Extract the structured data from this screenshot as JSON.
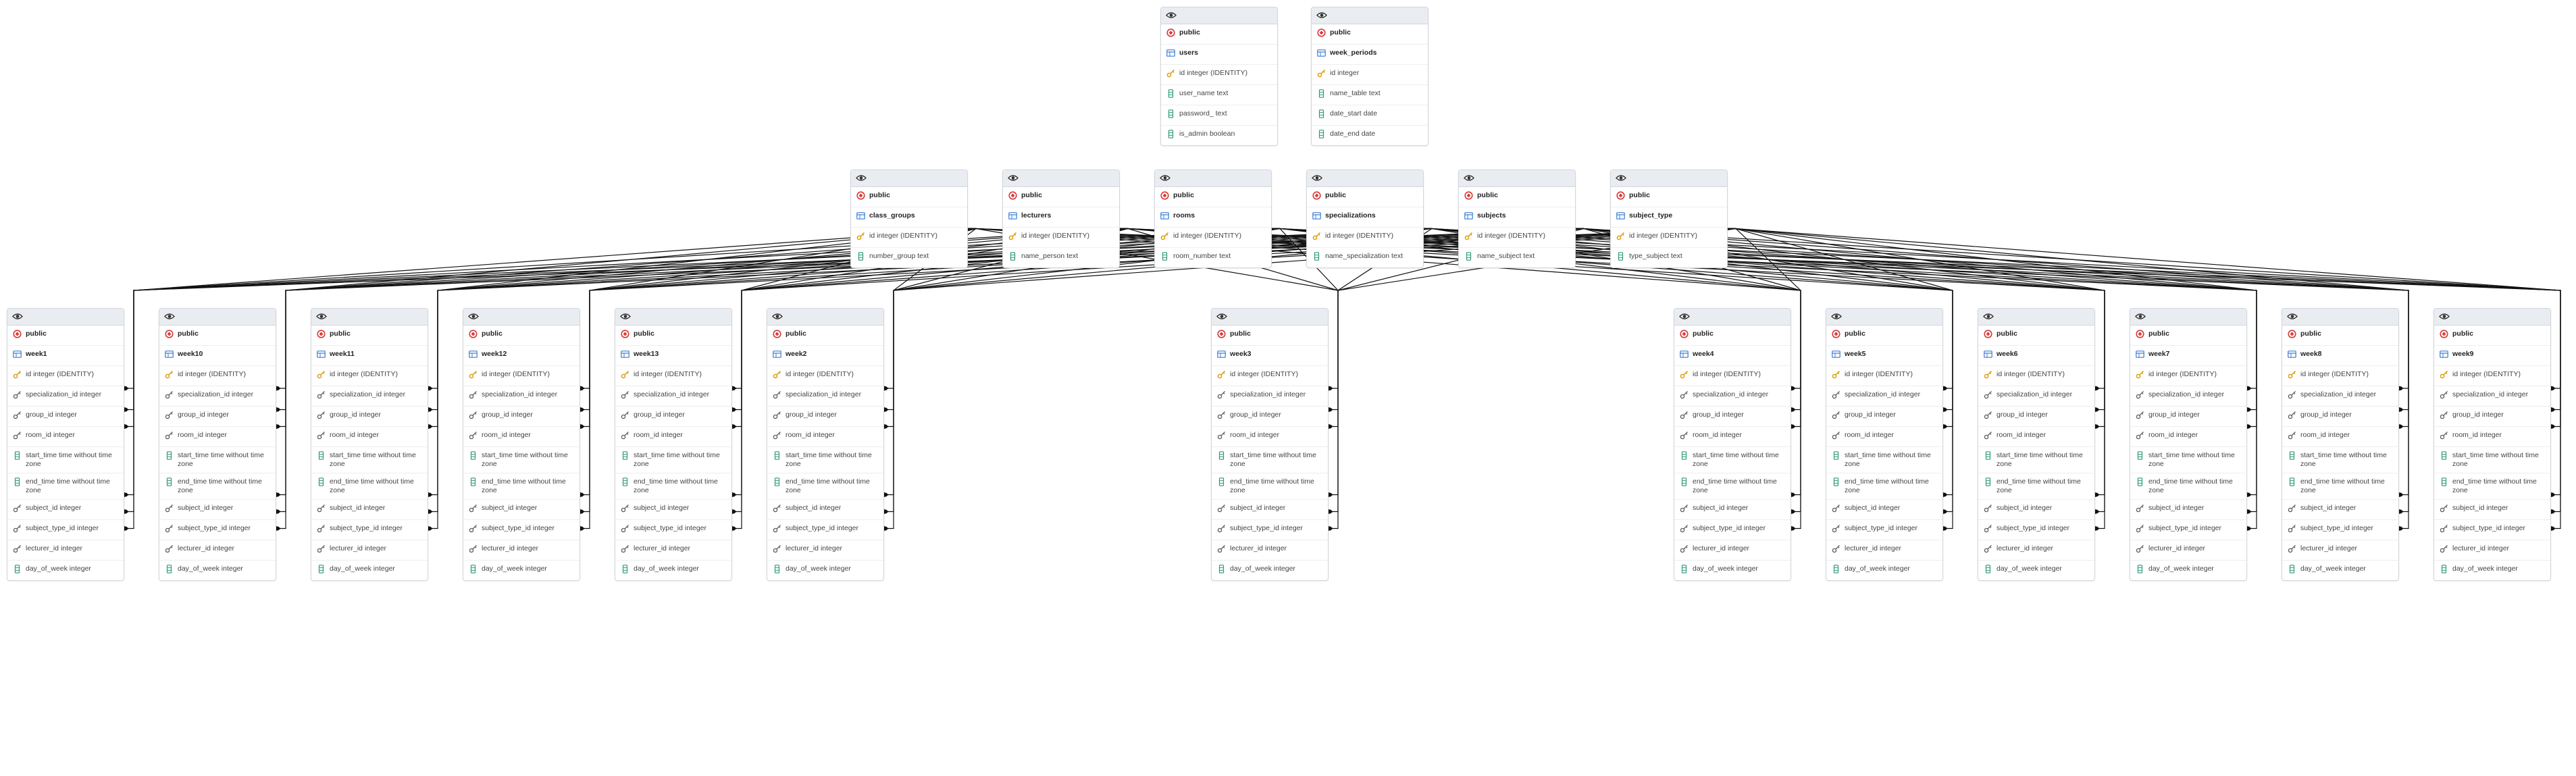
{
  "colors": {
    "header": "#e9ecf0",
    "border": "#d3d6dc",
    "edge": "#111111",
    "schema_icon": "#d93a3a",
    "table_icon": "#3a7bd5",
    "key_icon": "#e0a21a",
    "fk_icon": "#666666",
    "column_icon": "#2e9a7b"
  },
  "icons": {
    "header": "eye-icon",
    "schema": "schema-icon",
    "table": "table-icon",
    "primary_key": "key-icon",
    "foreign_key": "foreign-key-icon",
    "column": "column-icon"
  },
  "tables": [
    {
      "id": "users",
      "schema": "public",
      "name": "users",
      "columns": [
        {
          "label": "id integer (IDENTITY)",
          "kind": "pk"
        },
        {
          "label": "user_name text",
          "kind": "col"
        },
        {
          "label": "password_ text",
          "kind": "col"
        },
        {
          "label": "is_admin boolean",
          "kind": "col"
        }
      ]
    },
    {
      "id": "week_periods",
      "schema": "public",
      "name": "week_periods",
      "columns": [
        {
          "label": "id integer",
          "kind": "pk"
        },
        {
          "label": "name_table text",
          "kind": "col"
        },
        {
          "label": "date_start date",
          "kind": "col"
        },
        {
          "label": "date_end date",
          "kind": "col"
        }
      ]
    },
    {
      "id": "class_groups",
      "schema": "public",
      "name": "class_groups",
      "columns": [
        {
          "label": "id integer (IDENTITY)",
          "kind": "pk"
        },
        {
          "label": "number_group text",
          "kind": "col"
        }
      ]
    },
    {
      "id": "lecturers",
      "schema": "public",
      "name": "lecturers",
      "columns": [
        {
          "label": "id integer (IDENTITY)",
          "kind": "pk"
        },
        {
          "label": "name_person text",
          "kind": "col"
        }
      ]
    },
    {
      "id": "rooms",
      "schema": "public",
      "name": "rooms",
      "columns": [
        {
          "label": "id integer (IDENTITY)",
          "kind": "pk"
        },
        {
          "label": "room_number text",
          "kind": "col"
        }
      ]
    },
    {
      "id": "specializations",
      "schema": "public",
      "name": "specializations",
      "columns": [
        {
          "label": "id integer (IDENTITY)",
          "kind": "pk"
        },
        {
          "label": "name_specialization text",
          "kind": "col"
        }
      ]
    },
    {
      "id": "subjects",
      "schema": "public",
      "name": "subjects",
      "columns": [
        {
          "label": "id integer (IDENTITY)",
          "kind": "pk"
        },
        {
          "label": "name_subject text",
          "kind": "col"
        }
      ]
    },
    {
      "id": "subject_type",
      "schema": "public",
      "name": "subject_type",
      "columns": [
        {
          "label": "id integer (IDENTITY)",
          "kind": "pk"
        },
        {
          "label": "type_subject text",
          "kind": "col"
        }
      ]
    }
  ],
  "week_tables": [
    "week1",
    "week10",
    "week11",
    "week12",
    "week13",
    "week2",
    "week3",
    "week4",
    "week5",
    "week6",
    "week7",
    "week8",
    "week9"
  ],
  "week_schema": "public",
  "week_columns": [
    {
      "label": "id integer (IDENTITY)",
      "kind": "pk",
      "ref": ""
    },
    {
      "label": "specialization_id integer",
      "kind": "fk",
      "ref": "specializations"
    },
    {
      "label": "group_id integer",
      "kind": "fk",
      "ref": "class_groups"
    },
    {
      "label": "room_id integer",
      "kind": "fk",
      "ref": "rooms"
    },
    {
      "label": "start_time time without time zone",
      "kind": "col",
      "ref": ""
    },
    {
      "label": "end_time time without time zone",
      "kind": "col",
      "ref": ""
    },
    {
      "label": "subject_id integer",
      "kind": "fk",
      "ref": "subjects"
    },
    {
      "label": "subject_type_id integer",
      "kind": "fk",
      "ref": "subject_type"
    },
    {
      "label": "lecturer_id integer",
      "kind": "fk",
      "ref": "lecturers"
    },
    {
      "label": "day_of_week integer",
      "kind": "col",
      "ref": ""
    }
  ]
}
